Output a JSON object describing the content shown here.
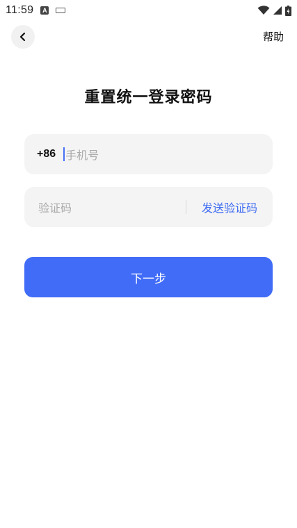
{
  "status_bar": {
    "time": "11:59",
    "icons": [
      "a-notification-icon",
      "keyboard-icon",
      "wifi-icon",
      "signal-icon",
      "battery-charging-icon"
    ]
  },
  "header": {
    "back_icon": "chevron-left-icon",
    "help_label": "帮助"
  },
  "page": {
    "title": "重置统一登录密码"
  },
  "phone_field": {
    "prefix": "+86",
    "placeholder": "手机号",
    "value": ""
  },
  "code_field": {
    "placeholder": "验证码",
    "value": "",
    "send_label": "发送验证码"
  },
  "next_button": {
    "label": "下一步"
  },
  "colors": {
    "accent": "#416cf7",
    "link": "#3f6cf2",
    "field_bg": "#f4f4f4"
  }
}
